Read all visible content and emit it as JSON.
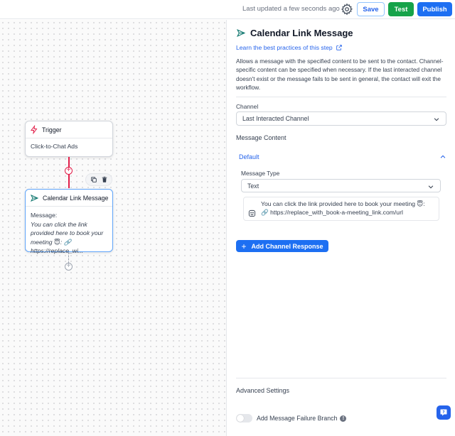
{
  "topbar": {
    "last_updated": "Last updated a few seconds ago",
    "save_label": "Save",
    "test_label": "Test",
    "publish_label": "Publish",
    "settings_icon": "gear-icon"
  },
  "canvas": {
    "trigger_node": {
      "title": "Trigger",
      "icon": "bolt-icon",
      "body": "Click-to-Chat Ads"
    },
    "message_node": {
      "title": "Calendar Link Message",
      "icon": "send-icon",
      "body_label": "Message:",
      "body_text": "You can click the link provided here to book your meeting 😇: 🔗 https://replace_wi..."
    },
    "tools": [
      "copy-icon",
      "trash-icon"
    ]
  },
  "panel": {
    "title": "Calendar Link Message",
    "title_icon": "send-icon",
    "learn_link": "Learn the best practices of this step",
    "description": "Allows a message with the specified content to be sent to the contact. Channel-specific content can be specified when necessary. If the last interacted channel doesn't exist or the message fails to be sent in general, the contact will exit the workflow.",
    "channel_label": "Channel",
    "channel_value": "Last Interacted Channel",
    "message_content_label": "Message Content",
    "accordion_label": "Default",
    "message_type_label": "Message Type",
    "message_type_value": "Text",
    "message_text_line1": "You can click the link provided here to book your meeting 😇:",
    "message_text_line2": "🔗 https://replace_with_book-a-meeting_link.com/url",
    "add_channel_response": "Add Channel Response",
    "advanced_settings": "Advanced Settings",
    "failure_branch_label": "Add Message Failure Branch",
    "failure_branch_enabled": false
  },
  "colors": {
    "primary": "#1d6ff2",
    "success": "#16a34a",
    "connector": "#e11d48"
  }
}
